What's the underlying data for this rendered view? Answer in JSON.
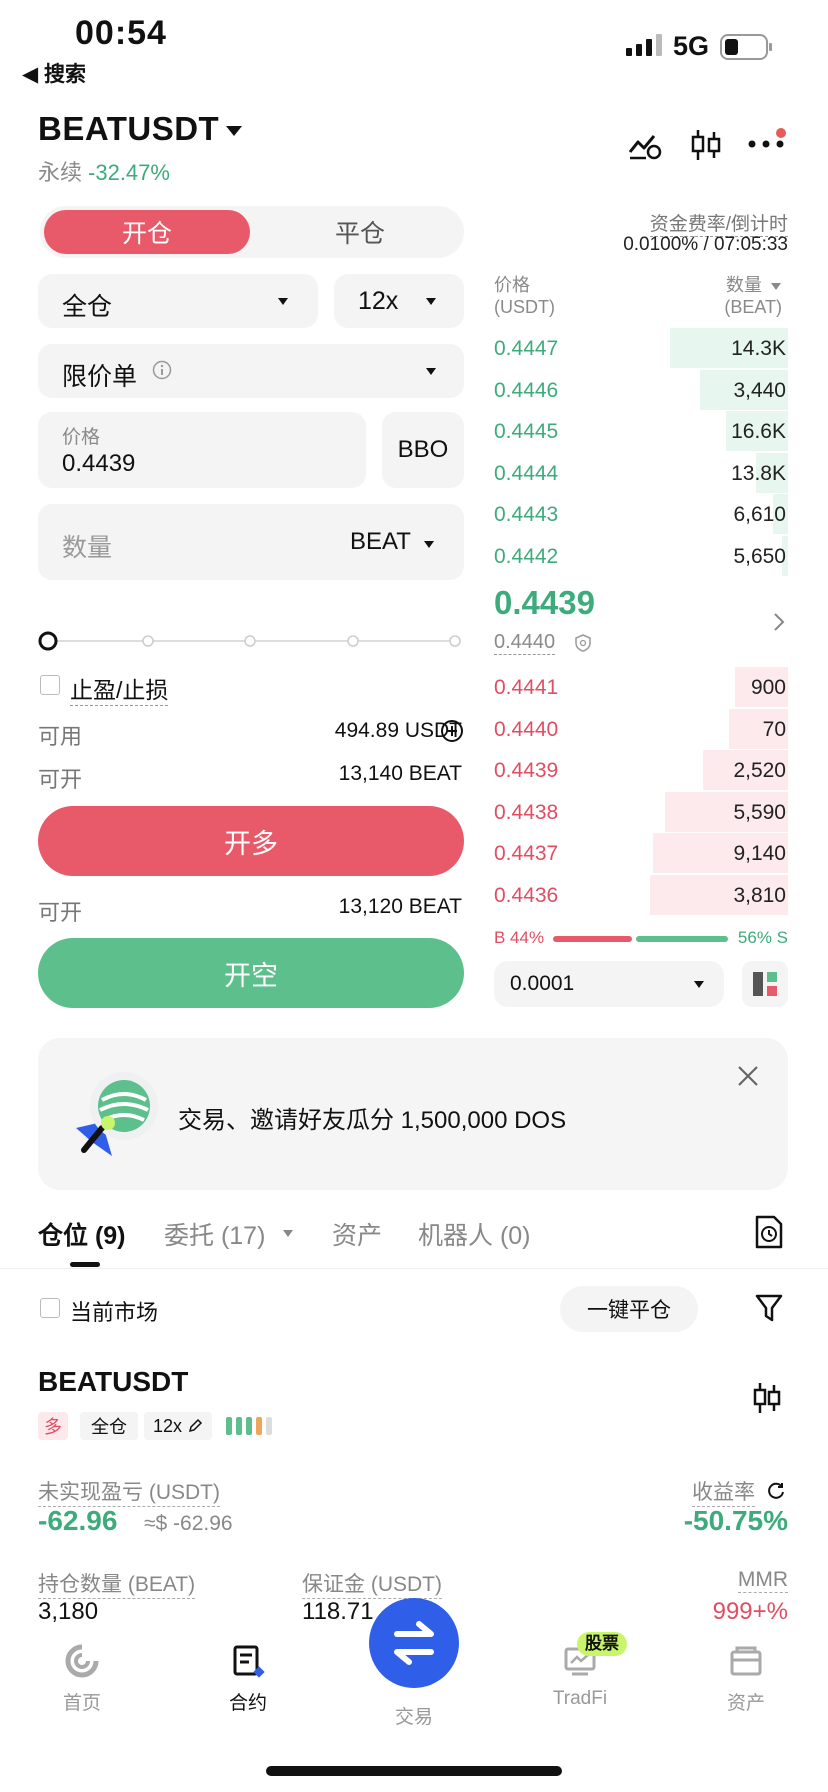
{
  "status_bar": {
    "time": "00:54",
    "back_label": "◀ 搜索",
    "network": "5G"
  },
  "header": {
    "pair": "BEATUSDT",
    "contract_type": "永续",
    "change_pct": "-32.47%"
  },
  "order_form": {
    "tab_open": "开仓",
    "tab_close": "平仓",
    "margin_mode": "全仓",
    "leverage": "12x",
    "order_type": "限价单",
    "price_label": "价格",
    "price_value": "0.4439",
    "bbo_label": "BBO",
    "qty_placeholder": "数量",
    "qty_unit": "BEAT",
    "tpsl_label": "止盈/止损",
    "available_label": "可用",
    "available_value": "494.89 USDT",
    "can_open_label": "可开",
    "can_open_long": "13,140 BEAT",
    "long_button": "开多",
    "can_open_short": "13,120 BEAT",
    "short_button": "开空"
  },
  "orderbook": {
    "funding_label": "资金费率/倒计时",
    "funding_value": "0.0100% / 07:05:33",
    "price_header": "价格",
    "price_unit": "(USDT)",
    "qty_header": "数量",
    "qty_unit": "(BEAT)",
    "asks": [
      {
        "price": "0.4447",
        "qty": "14.3K",
        "depth": 0.4
      },
      {
        "price": "0.4446",
        "qty": "3,440",
        "depth": 0.3
      },
      {
        "price": "0.4445",
        "qty": "16.6K",
        "depth": 0.21
      },
      {
        "price": "0.4444",
        "qty": "13.8K",
        "depth": 0.11
      },
      {
        "price": "0.4443",
        "qty": "6,610",
        "depth": 0.05
      },
      {
        "price": "0.4442",
        "qty": "5,650",
        "depth": 0.02
      }
    ],
    "last_price": "0.4439",
    "mark_price": "0.4440",
    "bids": [
      {
        "price": "0.4441",
        "qty": "900",
        "depth": 0.18
      },
      {
        "price": "0.4440",
        "qty": "70",
        "depth": 0.2
      },
      {
        "price": "0.4439",
        "qty": "2,520",
        "depth": 0.29
      },
      {
        "price": "0.4438",
        "qty": "5,590",
        "depth": 0.42
      },
      {
        "price": "0.4437",
        "qty": "9,140",
        "depth": 0.46
      },
      {
        "price": "0.4436",
        "qty": "3,810",
        "depth": 0.47
      }
    ],
    "buy_ratio": "B 44%",
    "sell_ratio": "56% S",
    "tick_size": "0.0001"
  },
  "banner": {
    "text": "交易、邀请好友瓜分 1,500,000 DOS"
  },
  "positions_tabs": {
    "positions": "仓位 (9)",
    "orders": "委托 (17)",
    "assets": "资产",
    "bots": "机器人 (0)"
  },
  "positions": {
    "current_market_label": "当前市场",
    "close_all_label": "一键平仓",
    "symbol": "BEATUSDT",
    "side_tag": "多",
    "margin_tag": "全仓",
    "leverage_tag": "12x",
    "upnl_label": "未实现盈亏 (USDT)",
    "upnl_value": "-62.96",
    "upnl_usd": "≈$ -62.96",
    "roe_label": "收益率",
    "roe_value": "-50.75%",
    "size_label": "持仓数量 (BEAT)",
    "size_value": "3,180",
    "margin_label": "保证金 (USDT)",
    "margin_value": "118.71",
    "mmr_label": "MMR",
    "mmr_value": "999+%"
  },
  "bottom_nav": {
    "home": "首页",
    "contract": "合约",
    "trade": "交易",
    "tradfi": "TradFi",
    "tradfi_badge": "股票",
    "assets": "资产"
  },
  "colors": {
    "red": "#e85a6a",
    "green": "#5cbf8c",
    "blue": "#2f5fe8"
  }
}
